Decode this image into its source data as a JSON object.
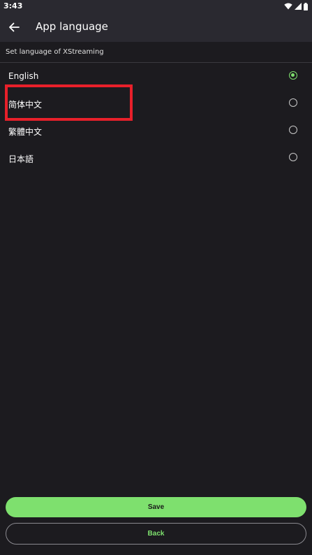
{
  "status_bar": {
    "time": "3:43",
    "icons": [
      "wifi-icon",
      "signal-icon",
      "battery-icon"
    ]
  },
  "app_bar": {
    "back_icon": "arrow-left-icon",
    "title": "App language"
  },
  "section": {
    "header": "Set language of XStreaming"
  },
  "languages": [
    {
      "label": "English",
      "selected": true
    },
    {
      "label": "简体中文",
      "selected": false
    },
    {
      "label": "繁體中文",
      "selected": false
    },
    {
      "label": "日本語",
      "selected": false
    }
  ],
  "actions": {
    "save_label": "Save",
    "back_label": "Back"
  },
  "colors": {
    "accent": "#7ee06e",
    "background": "#1c1b1f",
    "app_bar": "#2a2930",
    "highlight": "#e8202a"
  }
}
